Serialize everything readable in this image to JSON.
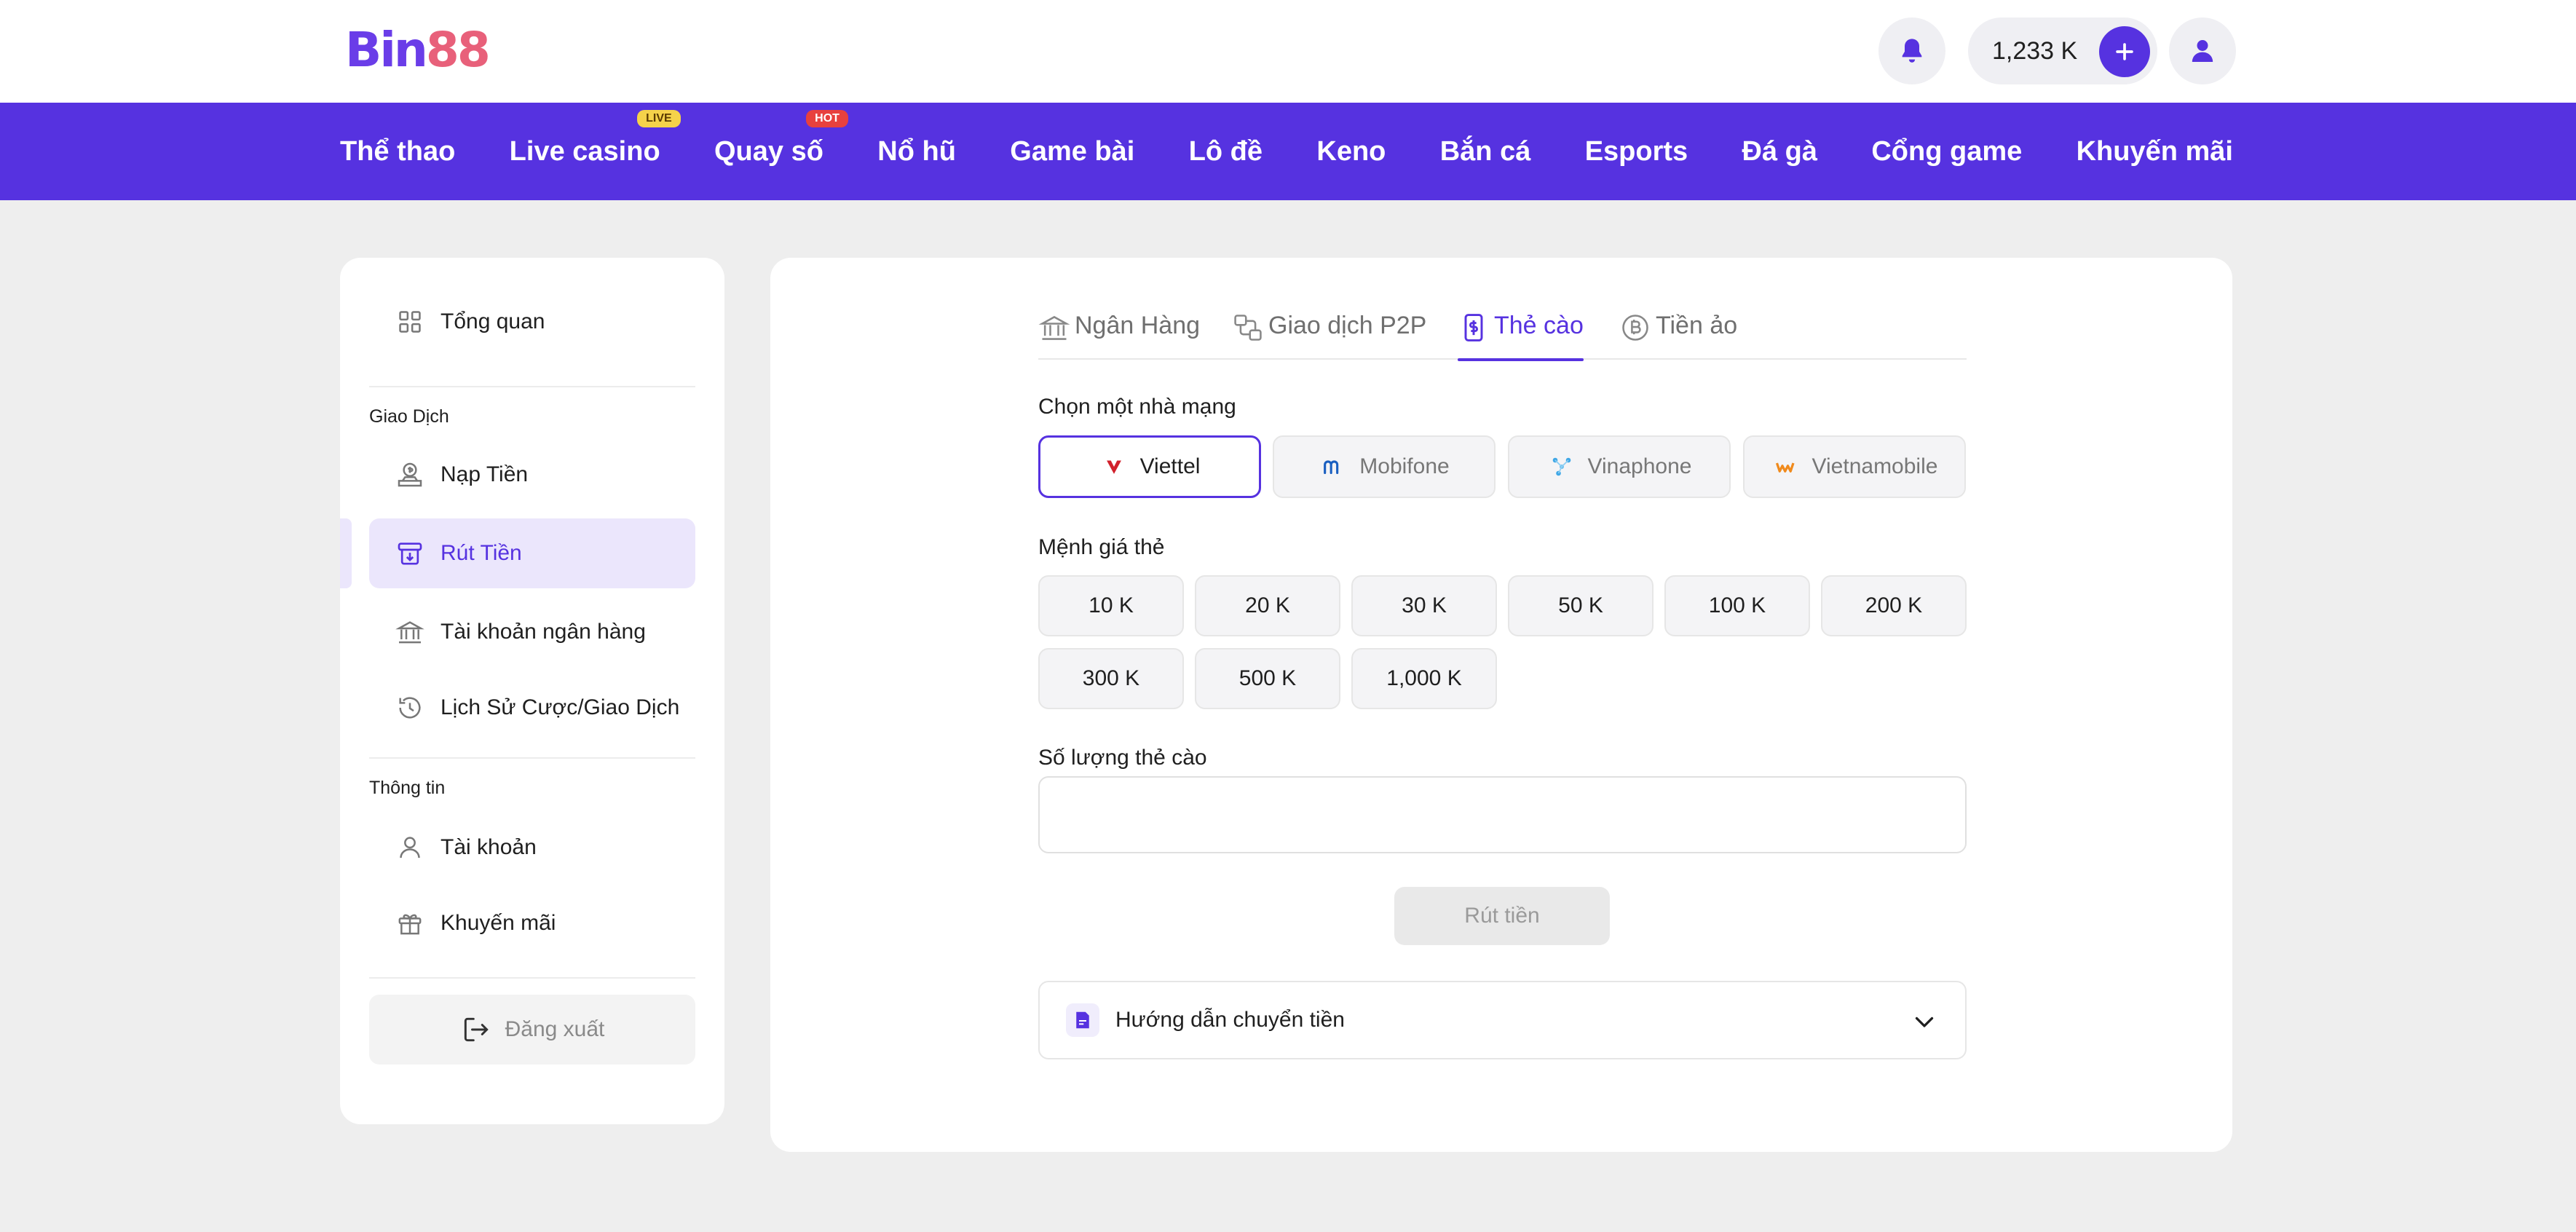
{
  "header": {
    "logo_b": "B",
    "logo_in": "in",
    "logo_88": "88",
    "balance": "1,233 K"
  },
  "nav": {
    "items": [
      {
        "label": "Thể thao"
      },
      {
        "label": "Live casino",
        "badge": "LIVE"
      },
      {
        "label": "Quay số",
        "badge": "HOT"
      },
      {
        "label": "Nổ hũ"
      },
      {
        "label": "Game bài"
      },
      {
        "label": "Lô đề"
      },
      {
        "label": "Keno"
      },
      {
        "label": "Bắn cá"
      },
      {
        "label": "Esports"
      },
      {
        "label": "Đá gà"
      },
      {
        "label": "Cổng game"
      },
      {
        "label": "Khuyến mãi"
      }
    ]
  },
  "sidebar": {
    "overview": "Tổng quan",
    "section_transactions": "Giao Dịch",
    "deposit": "Nạp Tiền",
    "withdraw": "Rút Tiền",
    "bank_account": "Tài khoản ngân hàng",
    "history": "Lịch Sử Cược/Giao Dịch",
    "section_info": "Thông tin",
    "account": "Tài khoản",
    "promotions": "Khuyến mãi",
    "logout": "Đăng xuất",
    "active_item": "withdraw"
  },
  "tabs": {
    "bank": "Ngân Hàng",
    "p2p": "Giao dịch P2P",
    "card": "Thẻ cào",
    "crypto": "Tiền ảo",
    "active": "card"
  },
  "form": {
    "carrier_label": "Chọn một nhà mạng",
    "carriers": [
      "Viettel",
      "Mobifone",
      "Vinaphone",
      "Vietnamobile"
    ],
    "selected_carrier": "Viettel",
    "denomination_label": "Mệnh giá thẻ",
    "denominations": [
      "10 K",
      "20 K",
      "30 K",
      "50 K",
      "100 K",
      "200 K",
      "300 K",
      "500 K",
      "1,000 K"
    ],
    "quantity_label": "Số lượng thẻ cào",
    "quantity_value": "",
    "submit_label": "Rút tiền",
    "guide_label": "Hướng dẫn chuyển tiền"
  },
  "colors": {
    "brand": "#5632e0",
    "brand_light": "#ebe6fc",
    "page_bg": "#eeeeee",
    "live_badge": "#f5d24a",
    "hot_badge": "#e8413e"
  }
}
